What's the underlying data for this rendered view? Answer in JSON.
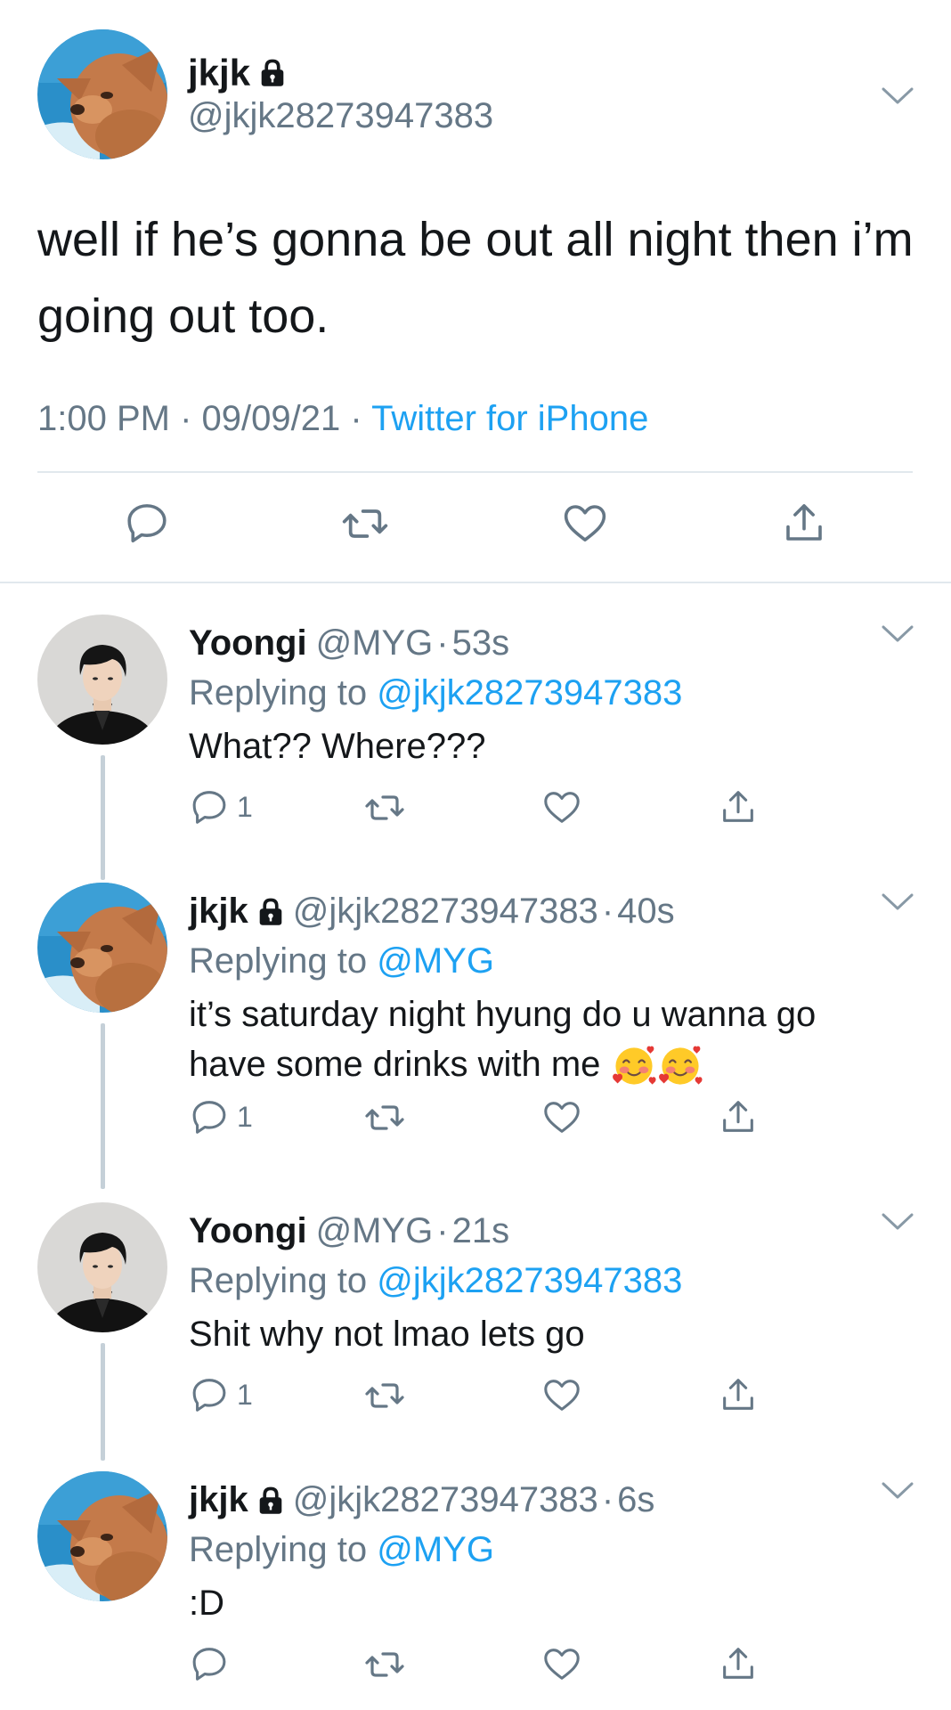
{
  "main_tweet": {
    "display_name": "jkjk",
    "handle": "@jkjk28273947383",
    "text": "well if he’s gonna be out all night then i’m going out too.",
    "time": "1:00 PM",
    "date": "09/09/21",
    "separator": "·",
    "source": "Twitter for iPhone"
  },
  "replies": [
    {
      "display_name": "Yoongi",
      "handle": "@MYG",
      "dot": "·",
      "time": "53s",
      "replying_prefix": "Replying to ",
      "replying_to": "@jkjk28273947383",
      "text": "What?? Where???",
      "reply_count": "1"
    },
    {
      "display_name": "jkjk",
      "handle": "@jkjk28273947383",
      "dot": "·",
      "time": "40s",
      "replying_prefix": "Replying to ",
      "replying_to": "@MYG",
      "text": "it’s saturday night hyung do u wanna go have some drinks with me",
      "emoji": "🥰🥰",
      "reply_count": "1"
    },
    {
      "display_name": "Yoongi",
      "handle": "@MYG",
      "dot": "·",
      "time": "21s",
      "replying_prefix": "Replying to ",
      "replying_to": "@jkjk28273947383",
      "text": "Shit why not lmao lets go",
      "reply_count": "1"
    },
    {
      "display_name": "jkjk",
      "handle": "@jkjk28273947383",
      "dot": "·",
      "time": "6s",
      "replying_prefix": "Replying to ",
      "replying_to": "@MYG",
      "text": ":D",
      "reply_count": ""
    }
  ],
  "colors": {
    "link": "#1da1f2",
    "secondary": "#657786",
    "divider": "#e1e8ed"
  },
  "icons": [
    "reply-icon",
    "retweet-icon",
    "like-icon",
    "share-icon",
    "lock-icon",
    "chevron-down-icon"
  ]
}
